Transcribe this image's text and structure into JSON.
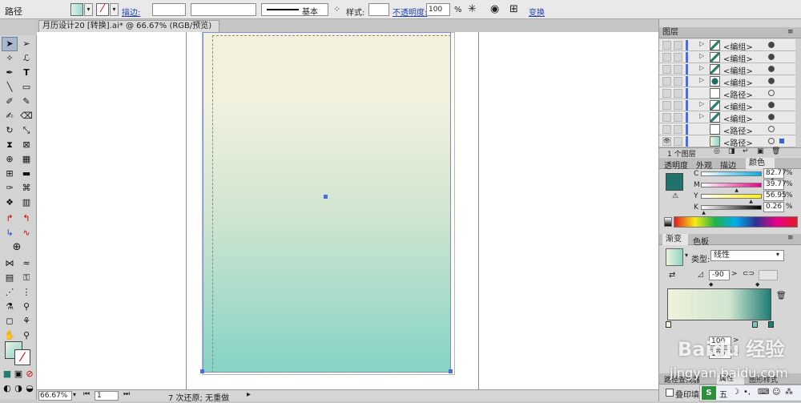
{
  "control_bar": {
    "object_type": "路径",
    "stroke_label": "描边:",
    "stroke_style": "基本",
    "style_label": "样式:",
    "opacity_label": "不透明度:",
    "opacity_value": "100",
    "opacity_unit": "%",
    "transform_label": "变换"
  },
  "document_tab": {
    "title": "月历设计20 [转换].ai* @ 66.67% (RGB/预览)"
  },
  "status_bar": {
    "zoom": "66.67%",
    "artboard": "1",
    "undo_status": "7 次还原; 无重做"
  },
  "layers_panel": {
    "title": "图层",
    "rows": [
      {
        "name": "<编组>",
        "expand": "▷",
        "thumb": "group"
      },
      {
        "name": "<编组>",
        "expand": "▷",
        "thumb": "group"
      },
      {
        "name": "<编组>",
        "expand": "▷",
        "thumb": "group"
      },
      {
        "name": "<编组>",
        "expand": "▷",
        "thumb": "dark"
      },
      {
        "name": "<路径>",
        "expand": "",
        "thumb": "blank"
      },
      {
        "name": "<编组>",
        "expand": "▷",
        "thumb": "group"
      },
      {
        "name": "<编组>",
        "expand": "▷",
        "thumb": "group"
      },
      {
        "name": "<路径>",
        "expand": "",
        "thumb": "blank"
      },
      {
        "name": "<路径>",
        "expand": "",
        "thumb": "gradient"
      }
    ],
    "footer": "1 个图层"
  },
  "color_panel": {
    "tabs": [
      "透明度",
      "外观",
      "描边",
      "颜色"
    ],
    "channels": [
      {
        "label": "C",
        "value": "82.77",
        "unit": "%"
      },
      {
        "label": "M",
        "value": "39.77",
        "unit": "%"
      },
      {
        "label": "Y",
        "value": "56.95",
        "unit": "%"
      },
      {
        "label": "K",
        "value": "0.26",
        "unit": "%"
      }
    ],
    "fill_color": "#20736b"
  },
  "gradient_panel": {
    "tabs": [
      "渐变",
      "色板"
    ],
    "type_label": "类型:",
    "type_value": "线性",
    "angle": "-90",
    "stop_color_start": "#f1f1dc",
    "stop_color_end": "#1f7d74",
    "opacity_field": "100",
    "location_field": "100"
  },
  "bottom_panel": {
    "tabs": [
      "路径查找器",
      "属性",
      "图形样式"
    ],
    "checkbox_label": "叠印填充"
  },
  "canvas": {
    "gradient_top": "#f1f1de",
    "gradient_mid": "#cfe5cf",
    "gradient_bottom": "#85d3c7"
  },
  "watermark": "Baidu 经验",
  "watermark_url": "jingyan.baidu.com"
}
